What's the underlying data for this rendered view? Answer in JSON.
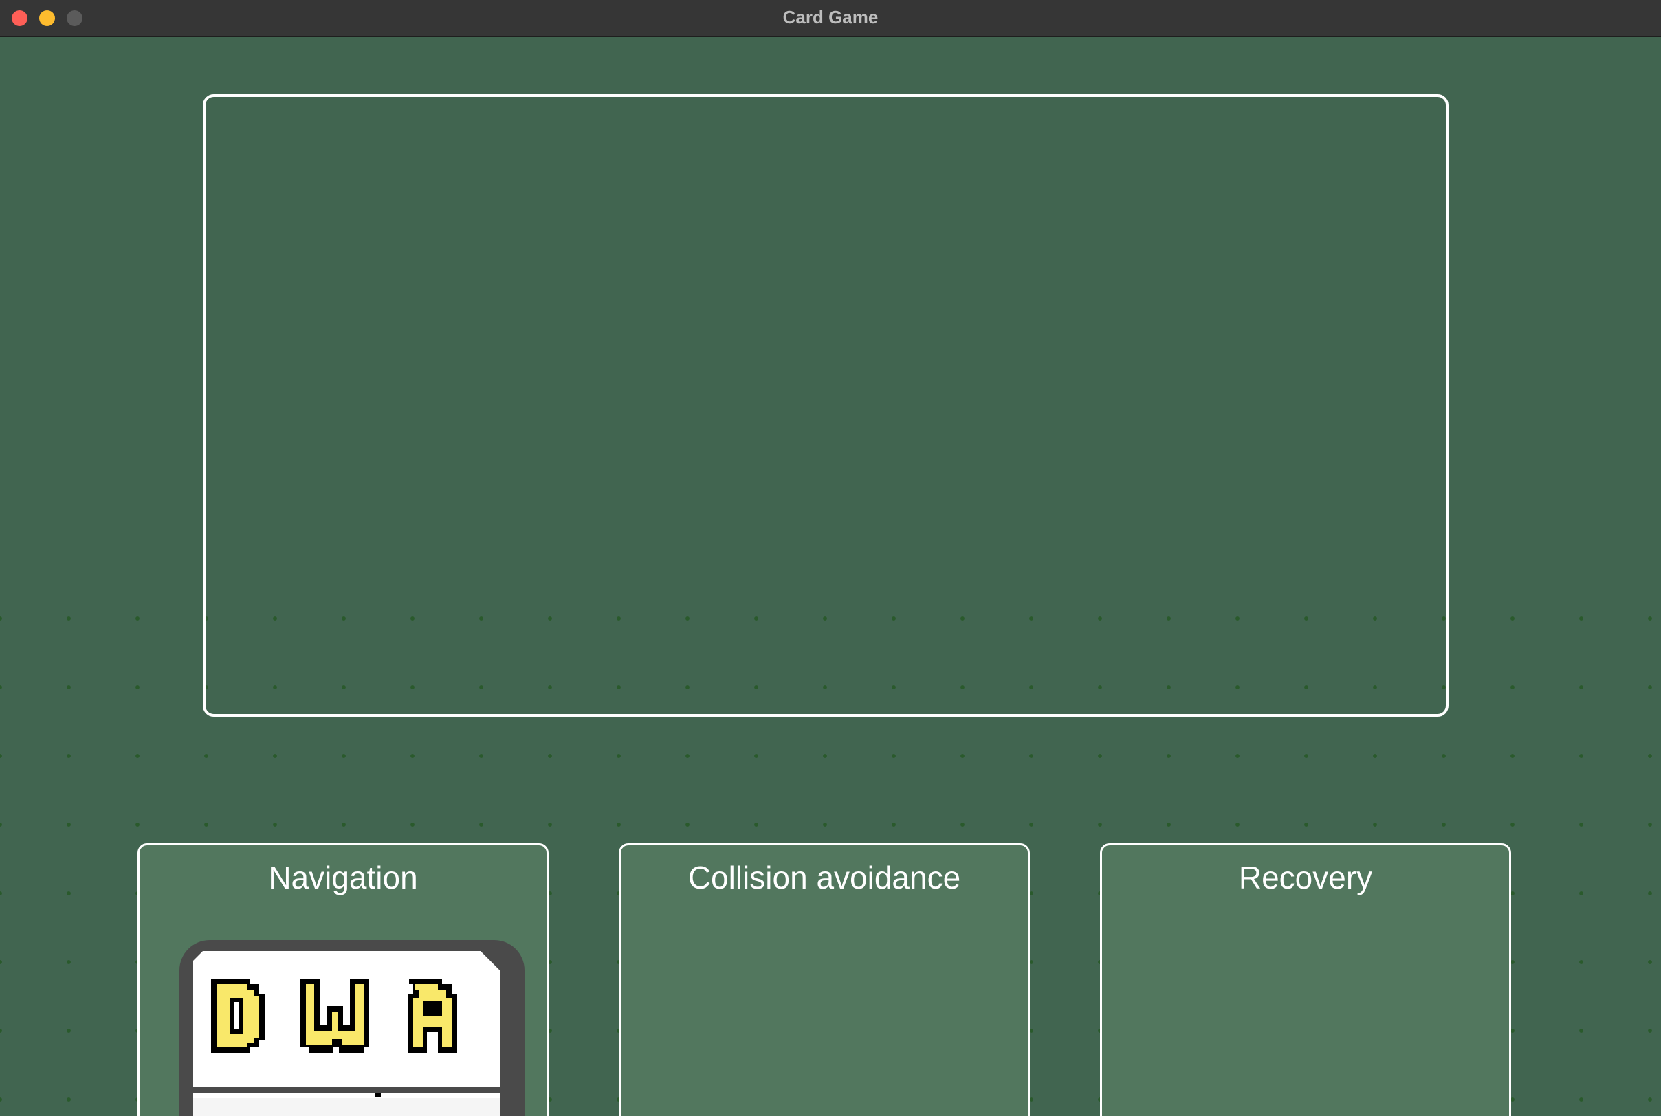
{
  "window": {
    "title": "Card Game"
  },
  "slots": [
    {
      "label": "Navigation"
    },
    {
      "label": "Collision avoidance"
    },
    {
      "label": "Recovery"
    }
  ],
  "card": {
    "code": "DWA",
    "letter_fill": "#f9e86a",
    "outline": "#000000"
  },
  "colors": {
    "felt": "#416550",
    "slot_fill": "#52775e",
    "border": "#ffffff",
    "titlebar": "#363636"
  }
}
